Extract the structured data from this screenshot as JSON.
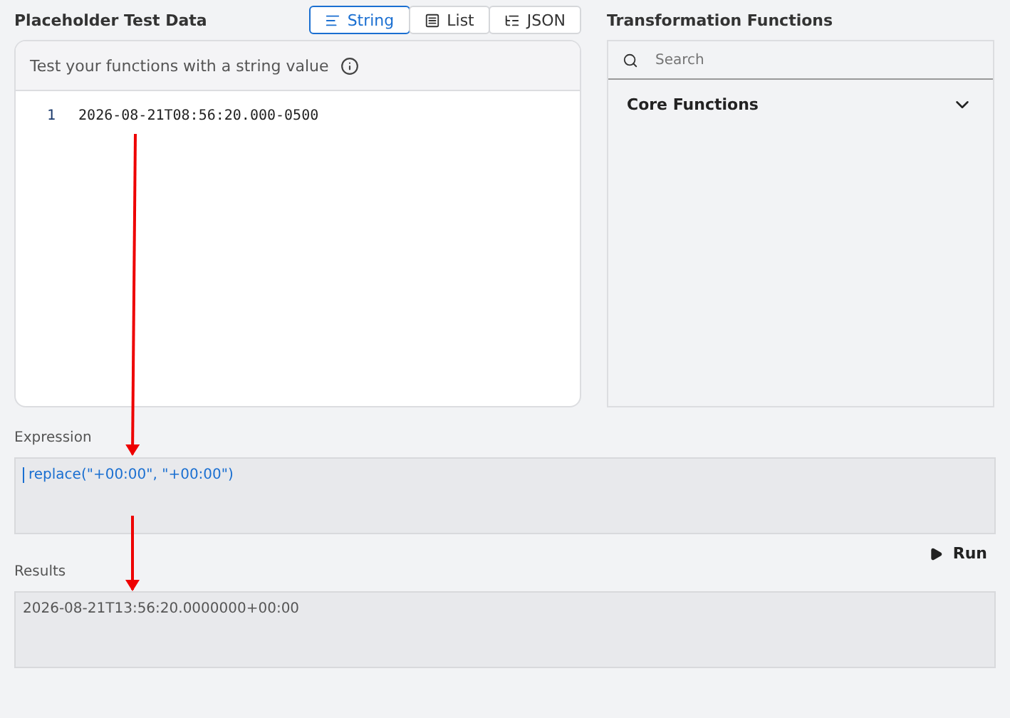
{
  "test_data": {
    "heading": "Placeholder Test Data",
    "modes": [
      {
        "label": "String",
        "selected": true,
        "kind": "lines"
      },
      {
        "label": "List",
        "selected": false,
        "kind": "list"
      },
      {
        "label": "JSON",
        "selected": false,
        "kind": "tree"
      }
    ],
    "hint": "Test your functions with a string value",
    "lines": [
      {
        "number": "1",
        "text": "2026-08-21T08:56:20.000-0500"
      }
    ]
  },
  "functions": {
    "heading": "Transformation Functions",
    "search": {
      "placeholder": "Search"
    },
    "groups": [
      {
        "title": "Core Functions",
        "expanded": false
      }
    ]
  },
  "expression": {
    "label": "Expression",
    "value": "replace(\"+00:00\", \"+00:00\")"
  },
  "run": {
    "label": "Run"
  },
  "results": {
    "label": "Results",
    "value": "2026-08-21T13:56:20.0000000+00:00"
  }
}
